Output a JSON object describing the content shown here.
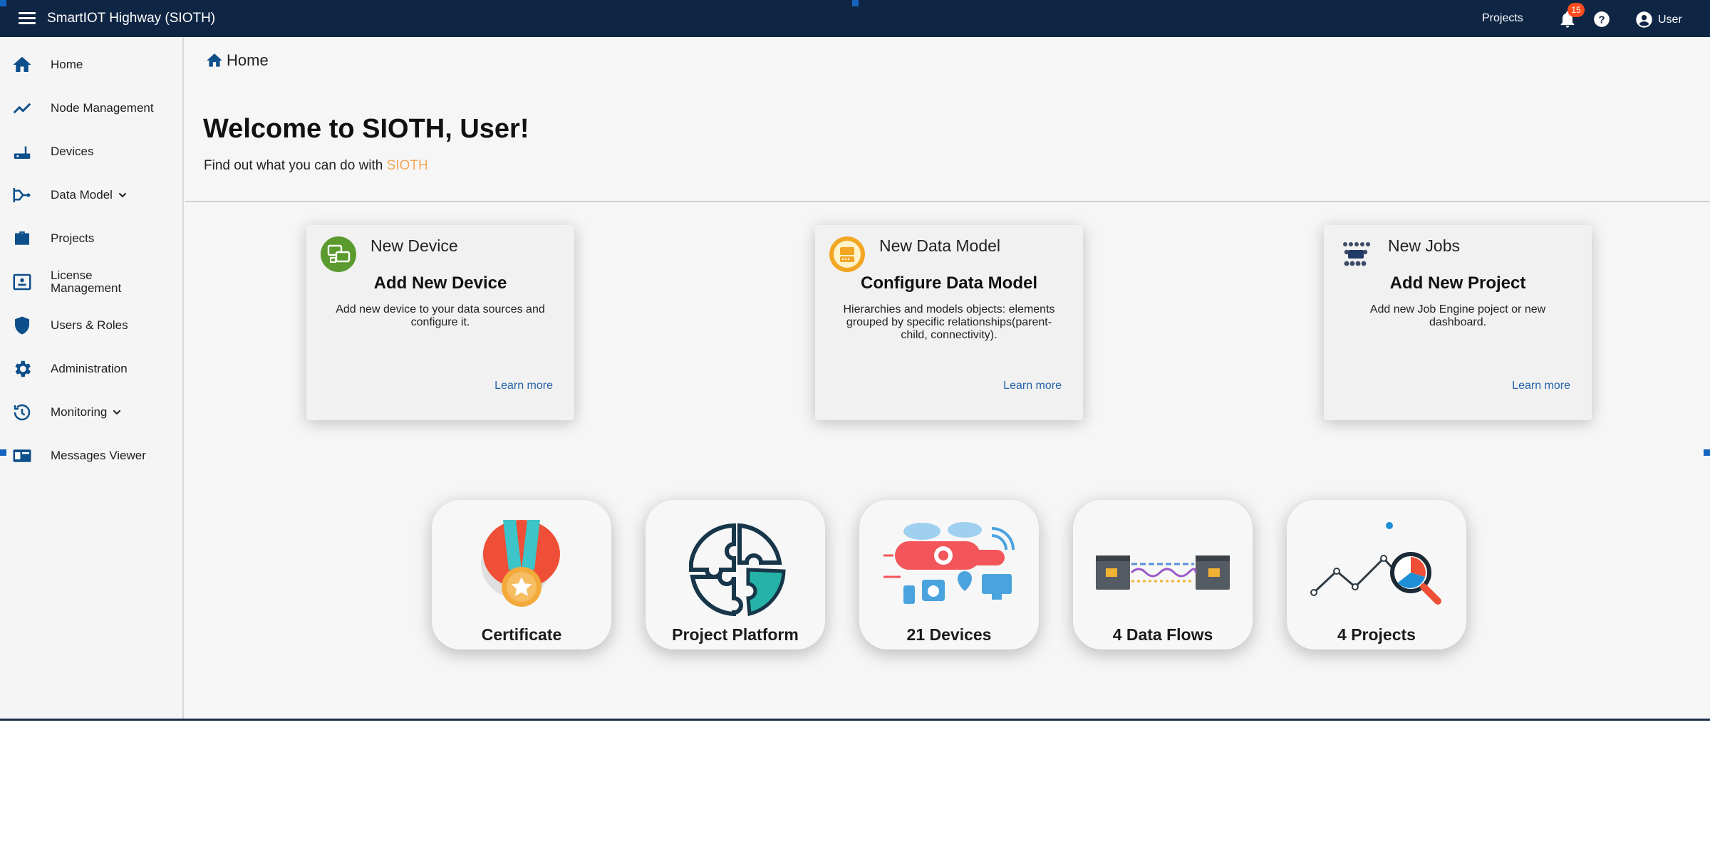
{
  "topbar": {
    "title": "SmartIOT Highway (SIOTH)",
    "projects_label": "Projects",
    "notification_count": "15",
    "user_label": "User"
  },
  "sidebar": {
    "items": [
      {
        "label": "Home",
        "icon": "home-icon"
      },
      {
        "label": "Node Management",
        "icon": "trend-icon"
      },
      {
        "label": "Devices",
        "icon": "router-icon"
      },
      {
        "label": "Data Model",
        "icon": "data-model-icon",
        "has_dropdown": true
      },
      {
        "label": "Projects",
        "icon": "briefcase-icon"
      },
      {
        "label": "License Management",
        "icon": "license-icon"
      },
      {
        "label": "Users & Roles",
        "icon": "shield-icon"
      },
      {
        "label": "Administration",
        "icon": "gear-icon"
      },
      {
        "label": "Monitoring",
        "icon": "history-icon",
        "has_dropdown": true
      },
      {
        "label": "Messages Viewer",
        "icon": "messages-icon"
      }
    ]
  },
  "main": {
    "breadcrumb": "Home",
    "welcome": "Welcome to SIOTH, User!",
    "subtext_prefix": "Find out what you can do with ",
    "subtext_brand": "SIOTH",
    "cards": [
      {
        "title": "New Device",
        "heading": "Add New Device",
        "description": "Add new device to your data sources and configure it.",
        "link": "Learn more"
      },
      {
        "title": "New Data Model",
        "heading": "Configure Data Model",
        "description": "Hierarchies and models objects: elements grouped by specific relationships(parent-child, connectivity).",
        "link": "Learn more"
      },
      {
        "title": "New Jobs",
        "heading": "Add New Project",
        "description": "Add new Job Engine poject or new dashboard.",
        "link": "Learn more"
      }
    ],
    "tiles": [
      {
        "label": "Certificate",
        "icon": "certificate-icon"
      },
      {
        "label": "Project Platform",
        "icon": "puzzle-icon"
      },
      {
        "label": "21 Devices",
        "icon": "devices-illustration-icon"
      },
      {
        "label": "4 Data Flows",
        "icon": "data-flows-icon"
      },
      {
        "label": "4 Projects",
        "icon": "projects-chart-icon"
      }
    ]
  },
  "colors": {
    "topbar": "#0f2544",
    "accent_blue": "#0d4f8b",
    "brand_orange": "#f0a85a",
    "badge": "#ff4d1f",
    "link": "#2563a8"
  }
}
